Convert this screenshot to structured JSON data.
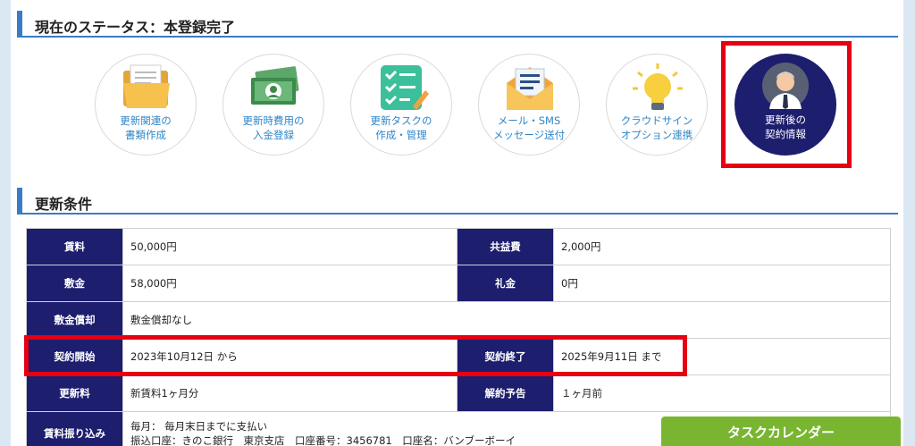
{
  "status": {
    "title": "現在のステータス：本登録完了"
  },
  "steps": [
    {
      "icon": "folder-documents-icon",
      "line1": "更新関連の",
      "line2": "書類作成"
    },
    {
      "icon": "money-bills-icon",
      "line1": "更新時費用の",
      "line2": "入金登録"
    },
    {
      "icon": "task-checklist-icon",
      "line1": "更新タスクの",
      "line2": "作成・管理"
    },
    {
      "icon": "mail-envelope-icon",
      "line1": "メール・SMS",
      "line2": "メッセージ送付"
    },
    {
      "icon": "lightbulb-icon",
      "line1": "クラウドサイン",
      "line2": "オプション連携"
    },
    {
      "icon": "person-avatar-icon",
      "line1": "更新後の",
      "line2": "契約情報",
      "active": true
    }
  ],
  "conditions": {
    "title": "更新条件",
    "rows": [
      {
        "k1": "賃料",
        "v1": "50,000円",
        "k2": "共益費",
        "v2": "2,000円"
      },
      {
        "k1": "敷金",
        "v1": "58,000円",
        "k2": "礼金",
        "v2": "0円"
      },
      {
        "k1": "敷金償却",
        "v1": "敷金償却なし"
      },
      {
        "k1": "契約開始",
        "v1": "2023年10月12日 から",
        "k2": "契約終了",
        "v2": "2025年9月11日 まで"
      },
      {
        "k1": "更新料",
        "v1": "新賃料1ヶ月分",
        "k2": "解約予告",
        "v2": "１ヶ月前"
      }
    ],
    "last_row": {
      "k1": "賃料振り込み",
      "line1": "毎月： 毎月末日までに支払い",
      "line2": "振込口座：きのこ銀行　東京支店　口座番号：3456781　口座名：バンブーボーイ"
    }
  },
  "task_button": {
    "label": "タスクカレンダー"
  },
  "colors": {
    "accent": "#3a7cc4",
    "header_cell": "#1d1e6e",
    "highlight": "#e60012",
    "button": "#7ab531",
    "link_text": "#2e86c8"
  }
}
